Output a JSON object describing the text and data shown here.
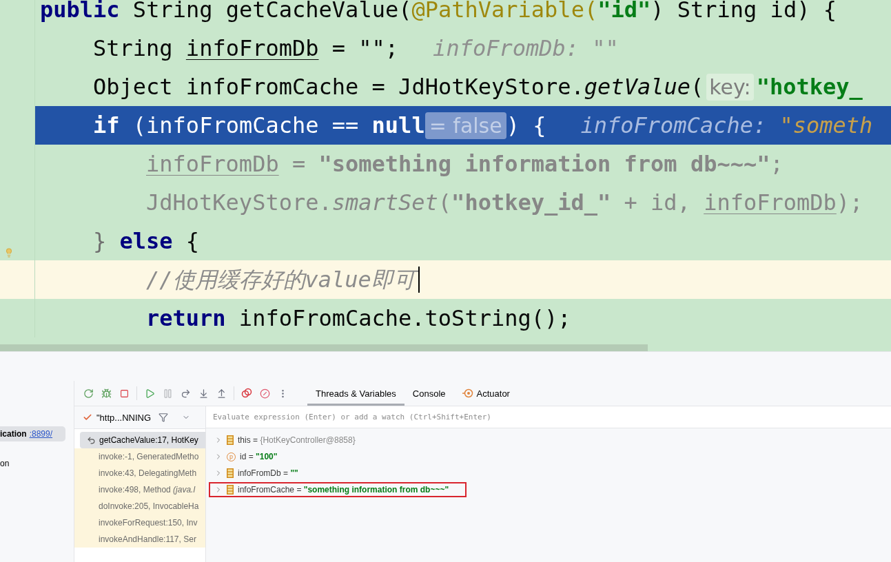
{
  "editor": {
    "lines": [
      {
        "kind": "normal",
        "tokens": [
          {
            "kind": "keyword",
            "text": "public"
          },
          {
            "kind": "plain",
            "text": " String getCacheValue("
          },
          {
            "kind": "annotation",
            "text": "@PathVariable("
          },
          {
            "kind": "string",
            "text": "\"id\""
          },
          {
            "kind": "plain",
            "text": ") String id) {"
          }
        ],
        "children": [
          {
            "kind": "normal",
            "dimmed": false,
            "tokens": [
              {
                "kind": "plain",
                "text": "String "
              },
              {
                "kind": "plain",
                "text": "infoFromDb",
                "underlined": true
              },
              {
                "kind": "plain",
                "text": " = \"\";"
              },
              {
                "kind": "debug_name",
                "text": "infoFromDb: \"\""
              }
            ]
          },
          {
            "kind": "normal",
            "dimmed": false,
            "tokens": [
              {
                "kind": "plain",
                "text": "Object infoFromCache = JdHotKeyStore."
              },
              {
                "kind": "method",
                "text": "getValue"
              },
              {
                "kind": "plain",
                "text": "("
              },
              {
                "kind": "hint",
                "text": "key:"
              },
              {
                "kind": "string",
                "text": "\"hotkey_"
              }
            ]
          },
          {
            "kind": "execution",
            "dimmed": false,
            "tokens": [
              {
                "kind": "keyword",
                "text": "if"
              },
              {
                "kind": "plain",
                "text": " (infoFromCache == "
              },
              {
                "kind": "keyword",
                "text": "null"
              },
              {
                "kind": "inline_value",
                "text": "= false"
              },
              {
                "kind": "plain",
                "text": ") {"
              },
              {
                "kind": "debug_name",
                "text": "infoFromCache: "
              },
              {
                "kind": "debug_string",
                "text": "\"someth"
              }
            ],
            "children": [
              {
                "kind": "normal",
                "dimmed": true,
                "tokens": [
                  {
                    "kind": "plain",
                    "text": "infoFromDb",
                    "underlined": true
                  },
                  {
                    "kind": "plain",
                    "text": " = "
                  },
                  {
                    "kind": "string",
                    "text": "\"something information from db~~~\""
                  },
                  {
                    "kind": "plain",
                    "text": ";"
                  }
                ]
              },
              {
                "kind": "normal",
                "dimmed": true,
                "tokens": [
                  {
                    "kind": "plain",
                    "text": "JdHotKeyStore."
                  },
                  {
                    "kind": "method",
                    "text": "smartSet"
                  },
                  {
                    "kind": "plain",
                    "text": "("
                  },
                  {
                    "kind": "string",
                    "text": "\"hotkey_id_\""
                  },
                  {
                    "kind": "plain",
                    "text": " + id, "
                  },
                  {
                    "kind": "plain",
                    "text": "infoFromDb",
                    "underlined": true
                  },
                  {
                    "kind": "plain",
                    "text": ");"
                  }
                ]
              }
            ]
          },
          {
            "kind": "normal",
            "dimmed": false,
            "bulb": true,
            "tokens": [
              {
                "kind": "brace",
                "text": "} "
              },
              {
                "kind": "keyword",
                "text": "else"
              },
              {
                "kind": "plain",
                "text": " {"
              }
            ],
            "children": [
              {
                "kind": "caret",
                "dimmed": false,
                "tokens": [
                  {
                    "kind": "comment",
                    "text": "//使用缓存好的value即可"
                  }
                ]
              },
              {
                "kind": "normal",
                "dimmed": false,
                "tokens": [
                  {
                    "kind": "keyword",
                    "text": "return"
                  },
                  {
                    "kind": "plain",
                    "text": " infoFromCache.toString();"
                  }
                ]
              }
            ]
          }
        ]
      }
    ]
  },
  "services": {
    "item": {
      "name": "ication",
      "port": ":8899/"
    },
    "extra": "on"
  },
  "toolbar": [
    {
      "kind": "rerun",
      "disabled": false
    },
    {
      "kind": "rerun_debug",
      "disabled": false
    },
    {
      "kind": "stop",
      "disabled": false
    },
    {
      "kind": "separator"
    },
    {
      "kind": "resume",
      "disabled": false
    },
    {
      "kind": "pause",
      "disabled": true
    },
    {
      "kind": "step_over",
      "disabled": false
    },
    {
      "kind": "step_into",
      "disabled": false
    },
    {
      "kind": "step_out",
      "disabled": false
    },
    {
      "kind": "separator"
    },
    {
      "kind": "breakpoints",
      "disabled": false
    },
    {
      "kind": "mute",
      "disabled": false
    },
    {
      "kind": "more",
      "disabled": false
    }
  ],
  "tabs": [
    {
      "label": "Threads & Variables",
      "selected": true
    },
    {
      "label": "Console",
      "selected": false
    },
    {
      "label": "Actuator",
      "selected": false,
      "icon": true
    }
  ],
  "thread": {
    "label": "\"http...NNING"
  },
  "frames": [
    {
      "label": "getCacheValue:17, HotKey",
      "selected": true,
      "library": false
    },
    {
      "label": "invoke:-1, GeneratedMetho",
      "selected": false,
      "library": true
    },
    {
      "label": "invoke:43, DelegatingMeth",
      "selected": false,
      "library": true
    },
    {
      "label": "invoke:498, Method ",
      "italic": "(java.l",
      "selected": false,
      "library": true
    },
    {
      "label": "doInvoke:205, InvocableHa",
      "selected": false,
      "library": true
    },
    {
      "label": "invokeForRequest:150, Inv",
      "selected": false,
      "library": true
    },
    {
      "label": "invokeAndHandle:117, Ser",
      "selected": false,
      "library": true
    }
  ],
  "evaluate": {
    "placeholder": "Evaluate expression (Enter) or add a watch (Ctrl+Shift+Enter)"
  },
  "variables": [
    {
      "kind": "field",
      "name": "this",
      "operator": "=",
      "value": {
        "kind": "object",
        "text": "{HotKeyController@8858}"
      },
      "highlighted": false
    },
    {
      "kind": "parameter",
      "badge": "p",
      "name": "id",
      "operator": "=",
      "value": {
        "kind": "string",
        "text": "\"100\""
      },
      "highlighted": false
    },
    {
      "kind": "field",
      "name": "infoFromDb",
      "operator": "=",
      "value": {
        "kind": "string",
        "text": "\"\""
      },
      "highlighted": false
    },
    {
      "kind": "field",
      "name": "infoFromCache",
      "operator": "=",
      "value": {
        "kind": "string",
        "text": "\"something information from db~~~\""
      },
      "highlighted": true
    }
  ]
}
